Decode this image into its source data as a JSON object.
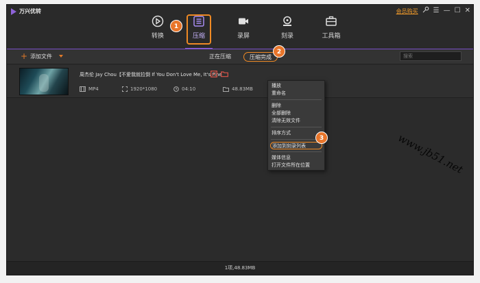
{
  "app": {
    "title": "万兴优转"
  },
  "window_controls": {
    "vip": "会员购买",
    "search_icon": "key-icon",
    "menu": "☰",
    "minimize": "—",
    "maximize": "☐",
    "close": "✕"
  },
  "nav": {
    "items": [
      {
        "label": "转换",
        "icon": "convert-icon"
      },
      {
        "label": "压缩",
        "icon": "compress-icon"
      },
      {
        "label": "录屏",
        "icon": "record-icon"
      },
      {
        "label": "刻录",
        "icon": "burn-icon"
      },
      {
        "label": "工具箱",
        "icon": "toolbox-icon"
      }
    ],
    "active": "压缩",
    "accent": "#8e63d8",
    "highlight": "#f08a24"
  },
  "toolbar": {
    "add_file": "添加文件",
    "tabs": [
      "正在压缩",
      "压缩完成"
    ],
    "search_placeholder": "搜索"
  },
  "file": {
    "name": "周杰伦 Jay Chou【不爱我就拉倒 If You Don't Love Me, It's Fine",
    "format": "MP4",
    "resolution": "1920*1080",
    "duration": "04:10",
    "size": "48.83MB"
  },
  "context_menu": {
    "items": [
      "播放",
      "重命名",
      "删除",
      "全部删除",
      "清除无效文件",
      "排序方式",
      "添加到刻录列表",
      "媒体信息",
      "打开文件所在位置"
    ]
  },
  "status": {
    "summary": "1项,48.83MB"
  },
  "badges": [
    "1",
    "2",
    "3"
  ],
  "watermark": "www.jb51.net"
}
